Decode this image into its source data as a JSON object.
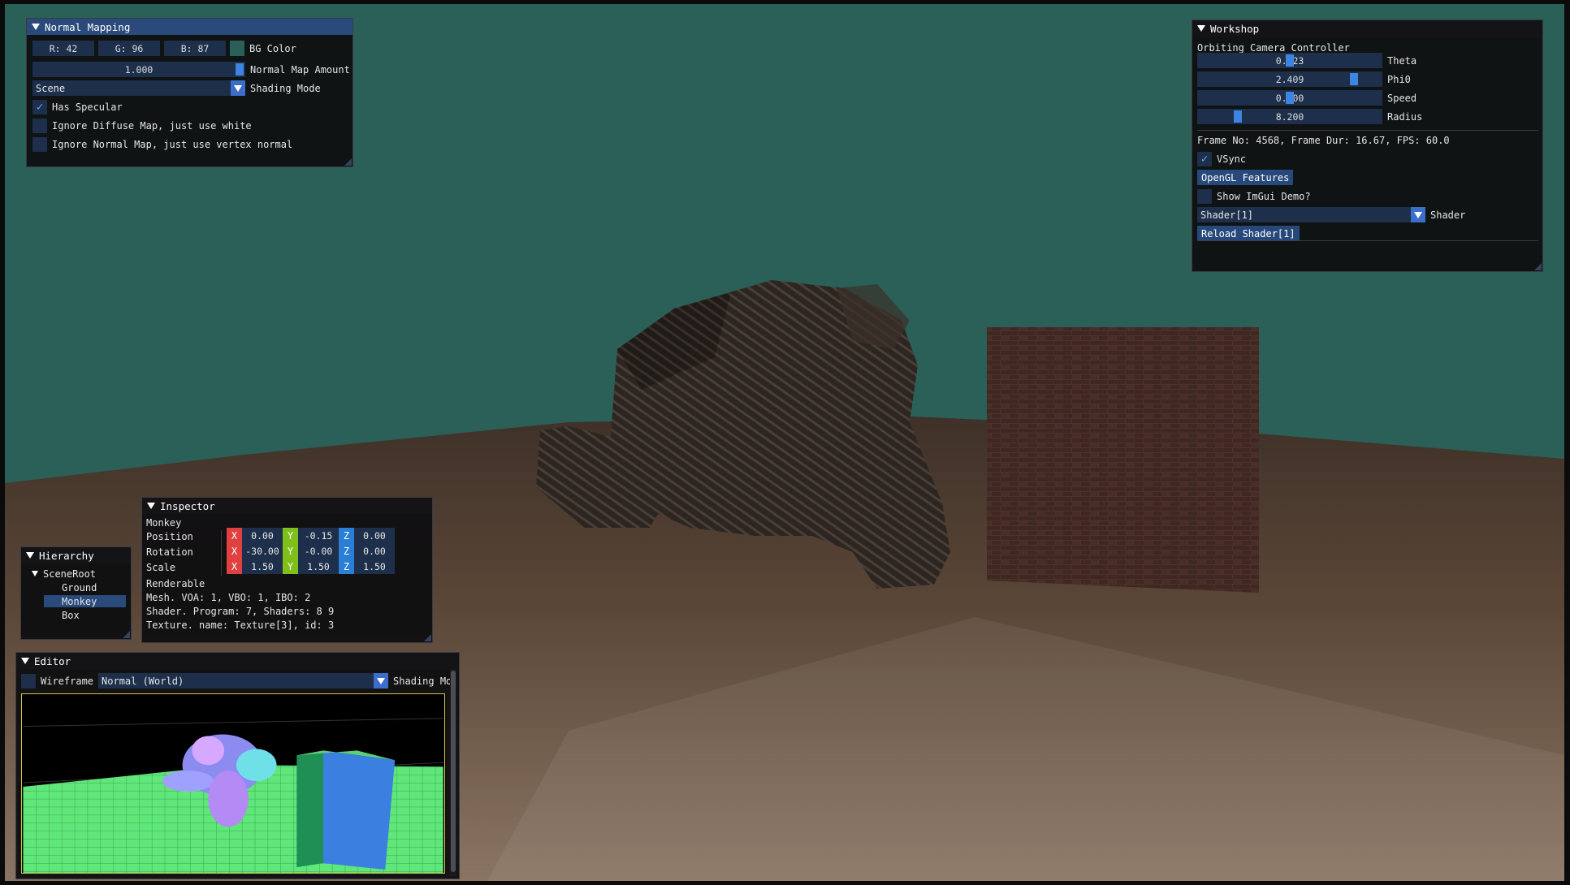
{
  "colors": {
    "bg_teal": "#2a6057",
    "title_active": "#294a7a",
    "field": "#1d2f4b",
    "axis_x": "#e04040",
    "axis_y": "#7fbf1a",
    "axis_z": "#2a7fd4"
  },
  "normal_mapping": {
    "title": "Normal Mapping",
    "bg_r": "R: 42",
    "bg_g": "G: 96",
    "bg_b": "B: 87",
    "bg_color_label": "BG Color",
    "normal_amount_value": "1.000",
    "normal_amount_label": "Normal Map Amount",
    "shading_value": "Scene",
    "shading_label": "Shading Mode",
    "has_specular": "Has Specular",
    "ignore_diffuse": "Ignore Diffuse Map, just use white",
    "ignore_normal": "Ignore Normal Map, just use vertex normal"
  },
  "workshop": {
    "title": "Workshop",
    "section": "Orbiting Camera Controller",
    "sliders": [
      {
        "value": "0.123",
        "label": "Theta",
        "level": 0.5
      },
      {
        "value": "2.409",
        "label": "Phi0",
        "level": 0.87
      },
      {
        "value": "0.000",
        "label": "Speed",
        "level": 0.5
      },
      {
        "value": "8.200",
        "label": "Radius",
        "level": 0.2
      }
    ],
    "frame_info": "Frame No:   4568, Frame Dur: 16.67, FPS: 60.0",
    "vsync": "VSync",
    "opengl_btn": "OpenGL Features",
    "show_demo": "Show ImGui Demo?",
    "shader_value": "Shader[1]",
    "shader_label": "Shader",
    "reload_btn": "Reload Shader[1]"
  },
  "inspector": {
    "title": "Inspector",
    "object": "Monkey",
    "position_label": "Position",
    "rotation_label": "Rotation",
    "scale_label": "Scale",
    "position": [
      "0.00",
      "-0.15",
      "0.00"
    ],
    "rotation": [
      "-30.00",
      "-0.00",
      "0.00"
    ],
    "scale": [
      "1.50",
      "1.50",
      "1.50"
    ],
    "axis_x": "X",
    "axis_y": "Y",
    "axis_z": "Z",
    "renderable": "Renderable",
    "mesh": "Mesh. VOA: 1, VBO: 1, IBO: 2",
    "shader": "Shader. Program: 7, Shaders: 8 9",
    "texture": "Texture. name: Texture[3], id: 3"
  },
  "hierarchy": {
    "title": "Hierarchy",
    "root": "SceneRoot",
    "items": [
      "Ground",
      "Monkey",
      "Box"
    ]
  },
  "editor": {
    "title": "Editor",
    "wireframe": "Wireframe",
    "mode_value": "Normal (World)",
    "mode_label": "Shading Mo"
  }
}
